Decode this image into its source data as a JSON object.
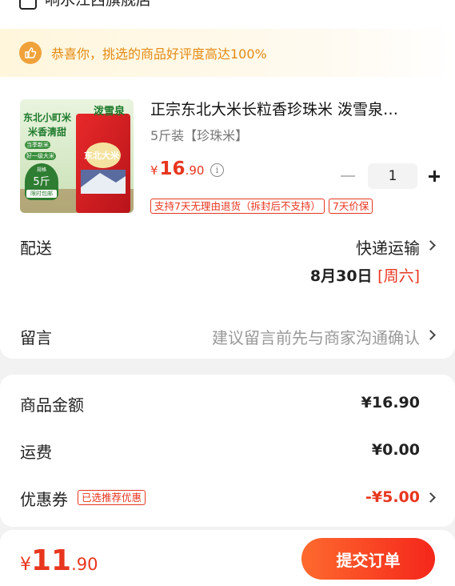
{
  "store": {
    "name": "响水江西旗舰店"
  },
  "congrats": {
    "text": "恭喜你，挑选的商品好评度高达100%"
  },
  "product": {
    "title": "正宗东北大米长粒香珍珠米 泼雪泉…",
    "spec": "5斤装【珍珠米】",
    "price_symbol": "¥",
    "price_int": "16",
    "price_dec": ".90",
    "quantity": "1",
    "tags": [
      "支持7天无理由退货（拆封后不支持）",
      "7天价保"
    ],
    "image_texts": {
      "brand": "泼雪泉",
      "slogan_line1": "东北小町米",
      "slogan_line2": "米香清甜",
      "badge1": "当季新米",
      "badge2": "好一级大米",
      "weight_label": "规格",
      "weight": "5斤",
      "shipping": "限时包邮",
      "bag_text": "东北大米"
    }
  },
  "delivery": {
    "label": "配送",
    "method": "快递运输",
    "date": "8月30日",
    "weekday": "[周六]"
  },
  "message": {
    "label": "留言",
    "placeholder": "建议留言前先与商家沟通确认"
  },
  "summary": {
    "goods_label": "商品金额",
    "goods_value": "¥16.90",
    "shipping_label": "运费",
    "shipping_value": "¥0.00",
    "coupon_label": "优惠券",
    "coupon_tag": "已选推荐优惠",
    "coupon_value": "-¥5.00"
  },
  "footer": {
    "total_symbol": "¥",
    "total_int": "11",
    "total_dec": ".90",
    "submit_label": "提交订单"
  },
  "colors": {
    "accent": "#e8361f",
    "congrats": "#e38a12",
    "submit_start": "#fe6a2e",
    "submit_end": "#f5261b"
  }
}
